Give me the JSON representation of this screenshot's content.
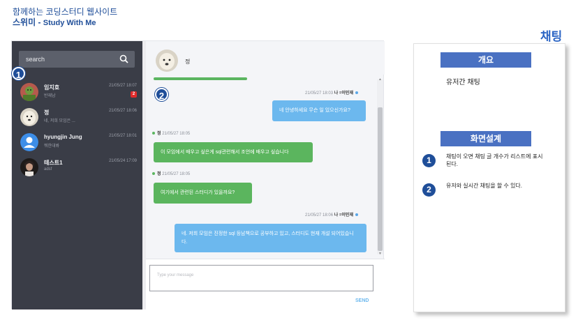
{
  "doc": {
    "title_line1": "함께하는 코딩스터디 웹사이트",
    "title_line2_ko": "스위미 - ",
    "title_line2_en": "Study With Me",
    "section": "채팅"
  },
  "sidebar": {
    "search_label": "search",
    "contacts": [
      {
        "name": "임지호",
        "preview": "반재남",
        "time": "21/05/27 18:07",
        "badge": "2"
      },
      {
        "name": "정",
        "preview": "네, 저희 모임은 ...",
        "time": "21/05/27 18:06",
        "badge": ""
      },
      {
        "name": "hyungjin Jung",
        "preview": "뭐한대봐",
        "time": "21/05/27 18:01",
        "badge": ""
      },
      {
        "name": "테스트1",
        "preview": "adsf",
        "time": "21/05/24 17:09",
        "badge": ""
      }
    ]
  },
  "chat": {
    "partner_name": "정",
    "messages": [
      {
        "side": "mine",
        "time": "21/05/27 18:03",
        "who": "나 =이민재",
        "text": "네 안녕하세요 무슨 일 있으신가요?"
      },
      {
        "side": "theirs",
        "time": "21/05/27 18:05",
        "who": "정",
        "text": "이 모임에서 배우고 싶은게 sql관련해서 조언에 배우고 싶습니다"
      },
      {
        "side": "theirs",
        "time": "21/05/27 18:05",
        "who": "정",
        "text": "여기에서 관련된 스터디가 있을까요?"
      },
      {
        "side": "mine",
        "time": "21/05/27 18:06",
        "who": "나 =이민재",
        "text": "네. 저희 모임은 진정한 sql 등남책으로 공부하고 있고, 스터디도 현재 개설 되어있습니다."
      }
    ],
    "composer_placeholder": "Type your message",
    "send_label": "SEND"
  },
  "callouts": [
    "1",
    "2"
  ],
  "panel": {
    "summary_heading": "개요",
    "summary_text": "유저간 채팅",
    "design_heading": "화면설계",
    "items": [
      {
        "num": "1",
        "text": "채팅이 오면 채팅 글 개수가 리스트에 표시된다."
      },
      {
        "num": "2",
        "text": "유저와 실시간 채팅을 할 수 있다."
      }
    ]
  },
  "colors": {
    "sidebar": "#3a3d47",
    "my_bubble": "#6cb8ee",
    "their_bubble": "#5bb55e",
    "heading_blue": "#4a71c2",
    "callout_blue": "#1f4e99",
    "badge_red": "#e02b2b"
  }
}
